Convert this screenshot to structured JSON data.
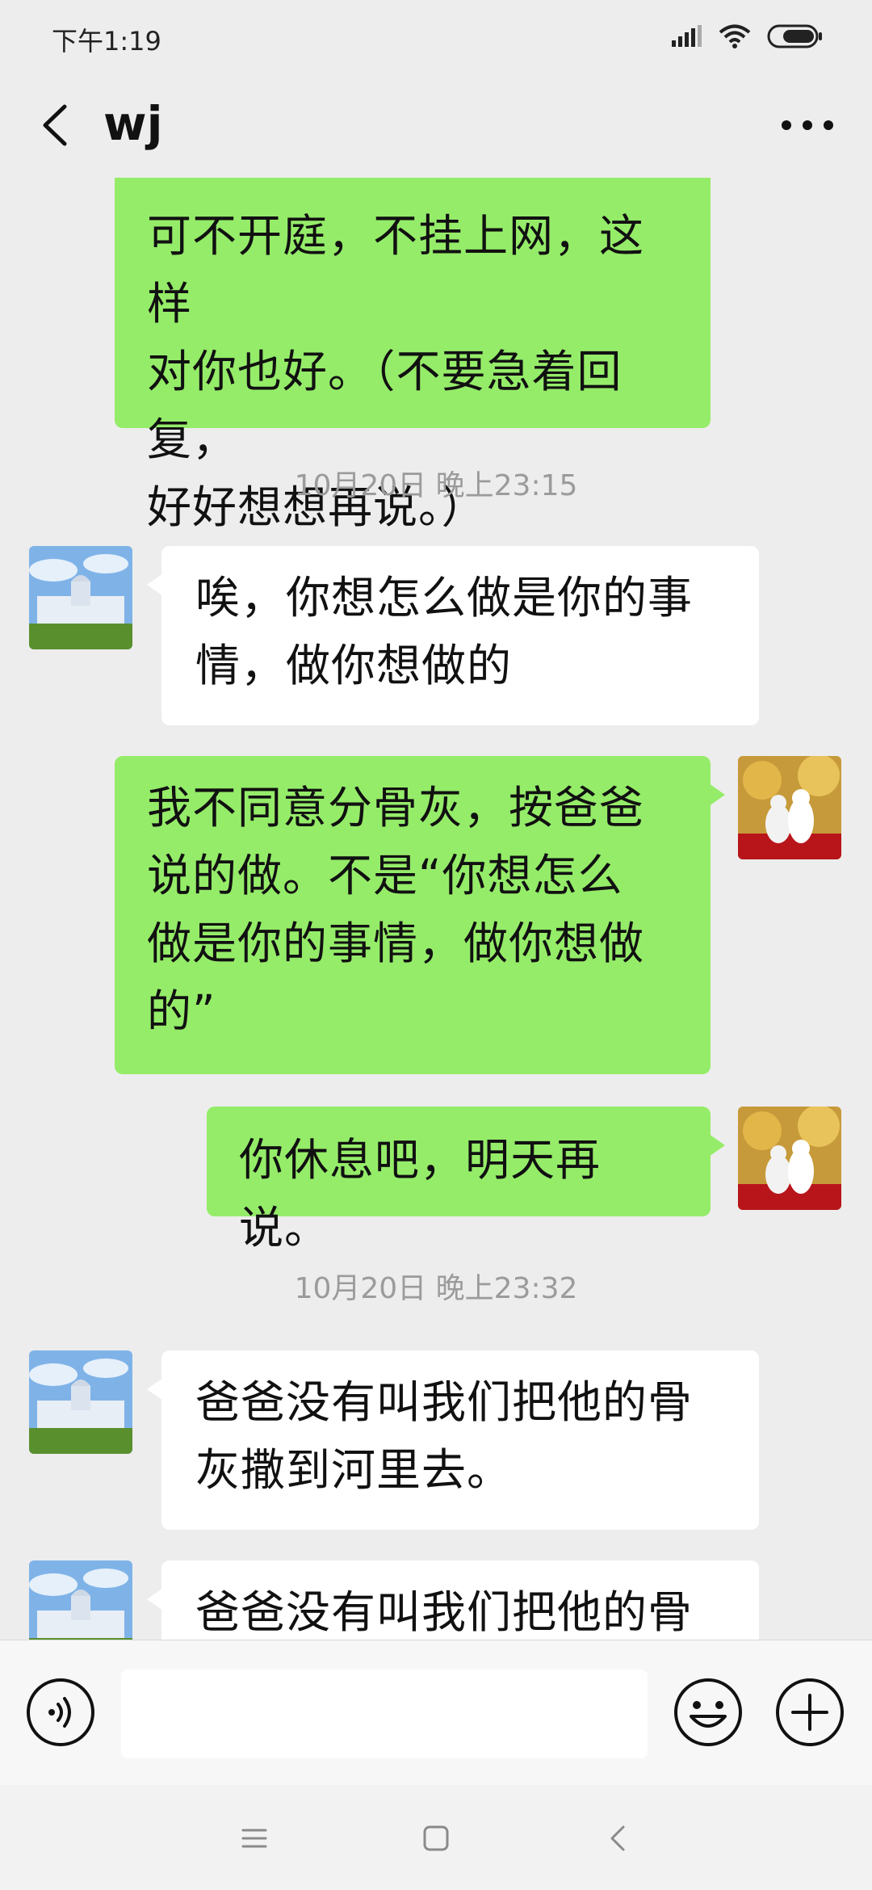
{
  "status_bar": {
    "time": "下午1:19",
    "icons": [
      "signal-icon",
      "wifi-icon",
      "battery-icon"
    ]
  },
  "header": {
    "title": "wj",
    "back_icon": "chevron-left-icon",
    "more_icon": "more-dots-icon"
  },
  "messages": [
    {
      "side": "me",
      "lines": [
        "可不开庭，不挂上网，这样",
        "对你也好。（不要急着回复，",
        "好好想想再说。）"
      ]
    },
    {
      "type": "timestamp",
      "text": "10月20日 晚上23:15"
    },
    {
      "side": "them",
      "lines": [
        "唉，你想怎么做是你的事",
        "情，做你想做的"
      ]
    },
    {
      "side": "me",
      "lines": [
        "我不同意分骨灰，按爸爸",
        "说的做。不是“你想怎么",
        "做是你的事情，做你想做",
        "的”"
      ]
    },
    {
      "side": "me",
      "lines": [
        "你休息吧，明天再说。"
      ]
    },
    {
      "type": "timestamp",
      "text": "10月20日 晚上23:32"
    },
    {
      "side": "them",
      "lines": [
        "爸爸没有叫我们把他的骨",
        "灰撒到河里去。"
      ]
    },
    {
      "side": "them",
      "lines": [
        "爸爸没有叫我们把他的骨"
      ]
    }
  ],
  "input_bar": {
    "voice_icon": "voice-icon",
    "placeholder": "",
    "emoji_icon": "emoji-icon",
    "plus_icon": "plus-icon"
  },
  "nav_bar": {
    "icons": [
      "menu-icon",
      "home-icon",
      "back-icon"
    ]
  },
  "colors": {
    "sent_bubble": "#95ec69",
    "received_bubble": "#ffffff",
    "background": "#ededed"
  }
}
